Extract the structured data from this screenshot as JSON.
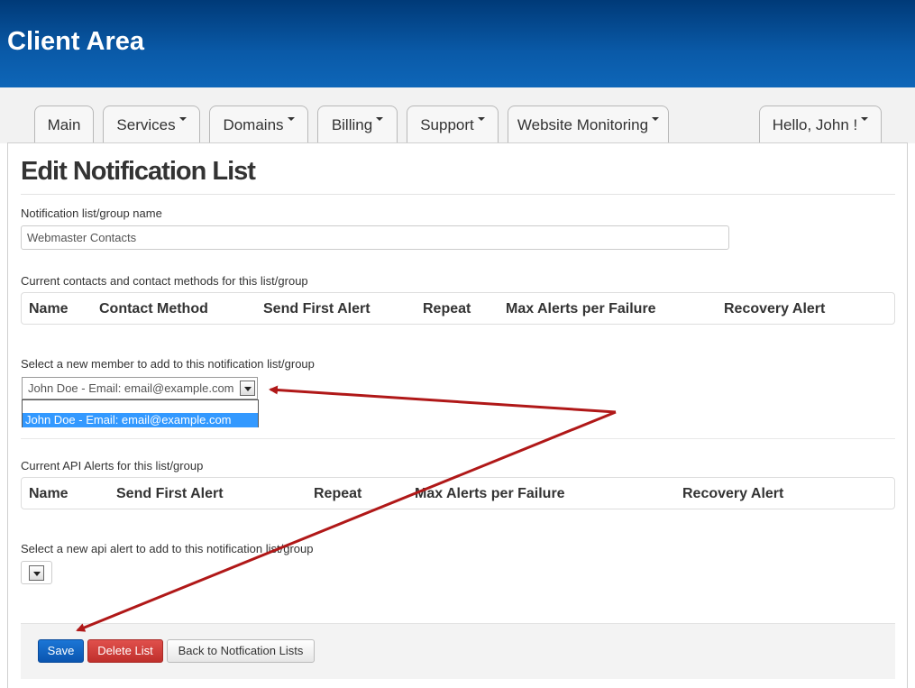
{
  "header": {
    "title": "Client Area"
  },
  "nav": {
    "tabs": [
      {
        "label": "Main",
        "has_dropdown": false
      },
      {
        "label": "Services",
        "has_dropdown": true
      },
      {
        "label": "Domains",
        "has_dropdown": true
      },
      {
        "label": "Billing",
        "has_dropdown": true
      },
      {
        "label": "Support",
        "has_dropdown": true
      },
      {
        "label": "Website Monitoring",
        "has_dropdown": true
      }
    ],
    "user_menu": {
      "label": "Hello, John !",
      "has_dropdown": true
    }
  },
  "page": {
    "title": "Edit Notification List",
    "list_name": {
      "label": "Notification list/group name",
      "value": "Webmaster Contacts"
    },
    "contacts": {
      "label": "Current contacts and contact methods for this list/group",
      "columns": [
        "Name",
        "Contact Method",
        "Send First Alert",
        "Repeat",
        "Max Alerts per Failure",
        "Recovery Alert"
      ]
    },
    "new_member": {
      "label": "Select a new member to add to this notification list/group",
      "selected": "John Doe - Email: email@example.com",
      "options": [
        "John Doe - Email: email@example.com"
      ]
    },
    "api_alerts": {
      "label": "Current API Alerts for this list/group",
      "columns": [
        "Name",
        "Send First Alert",
        "Repeat",
        "Max Alerts per Failure",
        "Recovery Alert"
      ]
    },
    "new_api_alert": {
      "label": "Select a new api alert to add to this notification list/group",
      "selected": ""
    },
    "buttons": {
      "save": "Save",
      "delete": "Delete List",
      "back": "Back to Notfication Lists"
    }
  },
  "colors": {
    "header_bg": "#0a5aa8",
    "save_button": "#0a55b0",
    "delete_button": "#c9302c",
    "selection_highlight": "#3399ff",
    "annotation_arrow": "#b01818"
  }
}
